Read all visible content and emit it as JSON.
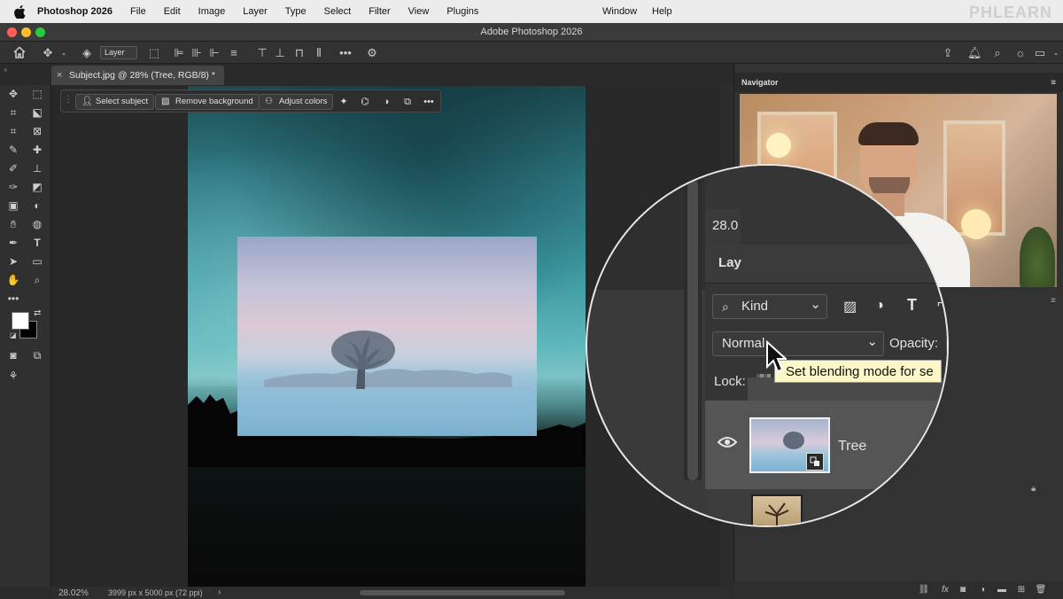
{
  "menubar": {
    "app_name": "Photoshop 2026",
    "items": [
      "File",
      "Edit",
      "Image",
      "Layer",
      "Type",
      "Select",
      "Filter",
      "View",
      "Plugins"
    ],
    "right_items": [
      "Window",
      "Help"
    ],
    "brand": "PHLEARN"
  },
  "window": {
    "title": "Adobe Photoshop 2026"
  },
  "options_bar": {
    "auto_select_target": "Layer"
  },
  "document_tab": {
    "label": "Subject.jpg @ 28% (Tree, RGB/8) *"
  },
  "contextual_taskbar": {
    "select_subject": "Select subject",
    "remove_background": "Remove background",
    "adjust_colors": "Adjust colors"
  },
  "status_bar": {
    "zoom": "28.02%",
    "doc_size": "3999 px x 5000 px (72 ppi)",
    "arrow": "›"
  },
  "navigator": {
    "title": "Navigator",
    "zoom": "28.0"
  },
  "layers_panel": {
    "title": "Lay",
    "filter_kind": "Kind",
    "blend_mode": "Normal",
    "opacity_label": "Opacity:",
    "lock_label": "Lock:",
    "tooltip": "Set blending mode for se",
    "layers": [
      {
        "name": "Tree",
        "selected": true
      },
      {
        "name": "",
        "locked": true
      }
    ]
  },
  "colors": {
    "ui_dark": "#323232",
    "foreground": "#ffffff",
    "background": "#000000",
    "tooltip_bg": "#fbf7c6"
  }
}
